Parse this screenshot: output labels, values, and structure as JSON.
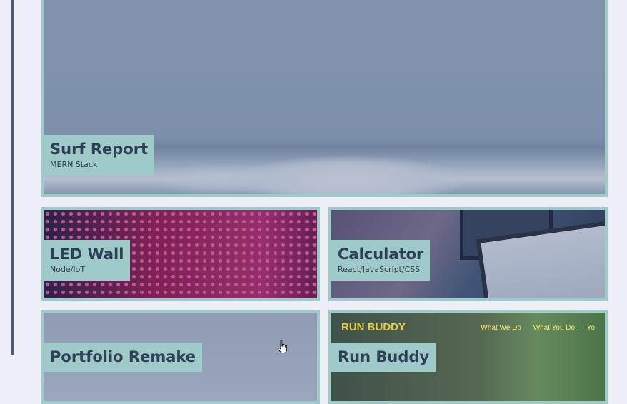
{
  "projects": [
    {
      "title": "Surf Report",
      "subtitle": "MERN Stack"
    },
    {
      "title": "LED Wall",
      "subtitle": "Node/IoT"
    },
    {
      "title": "Calculator",
      "subtitle": "React/JavaScript/CSS"
    },
    {
      "title": "Portfolio Remake",
      "subtitle": ""
    },
    {
      "title": "Run Buddy",
      "subtitle": ""
    }
  ],
  "run_buddy_preview": {
    "brand": "RUN BUDDY",
    "nav": [
      "What We Do",
      "What You Do",
      "Yo"
    ]
  },
  "colors": {
    "card_border": "#9ecaca",
    "label_text": "#2e3f56",
    "page_bg": "#eeeef6",
    "left_rule": "#4a5a78"
  }
}
